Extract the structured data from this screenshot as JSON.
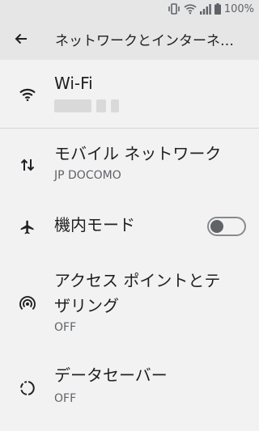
{
  "status": {
    "battery": "100%"
  },
  "appbar": {
    "title": "ネットワークとインターネ…"
  },
  "items": [
    {
      "title": "Wi-Fi",
      "sub": ""
    },
    {
      "title": "モバイル ネットワーク",
      "sub": "JP DOCOMO"
    },
    {
      "title": "機内モード",
      "toggle": "off"
    },
    {
      "title": "アクセス ポイントとテザリング",
      "line1": "アクセス ポイントとテ",
      "line2": "ザリング",
      "sub": "OFF"
    },
    {
      "title": "データセーバー",
      "sub": "OFF"
    }
  ],
  "colors": {
    "bar": "#e6e6e6",
    "bg": "#f2f2f2",
    "text": "#202124",
    "subtext": "#5f6368"
  },
  "icons": [
    "vibrate-icon",
    "wifi-icon",
    "signal-icon",
    "battery-icon",
    "back-arrow-icon",
    "wifi-icon",
    "mobile-data-icon",
    "airplane-icon",
    "hotspot-icon",
    "data-saver-icon"
  ]
}
